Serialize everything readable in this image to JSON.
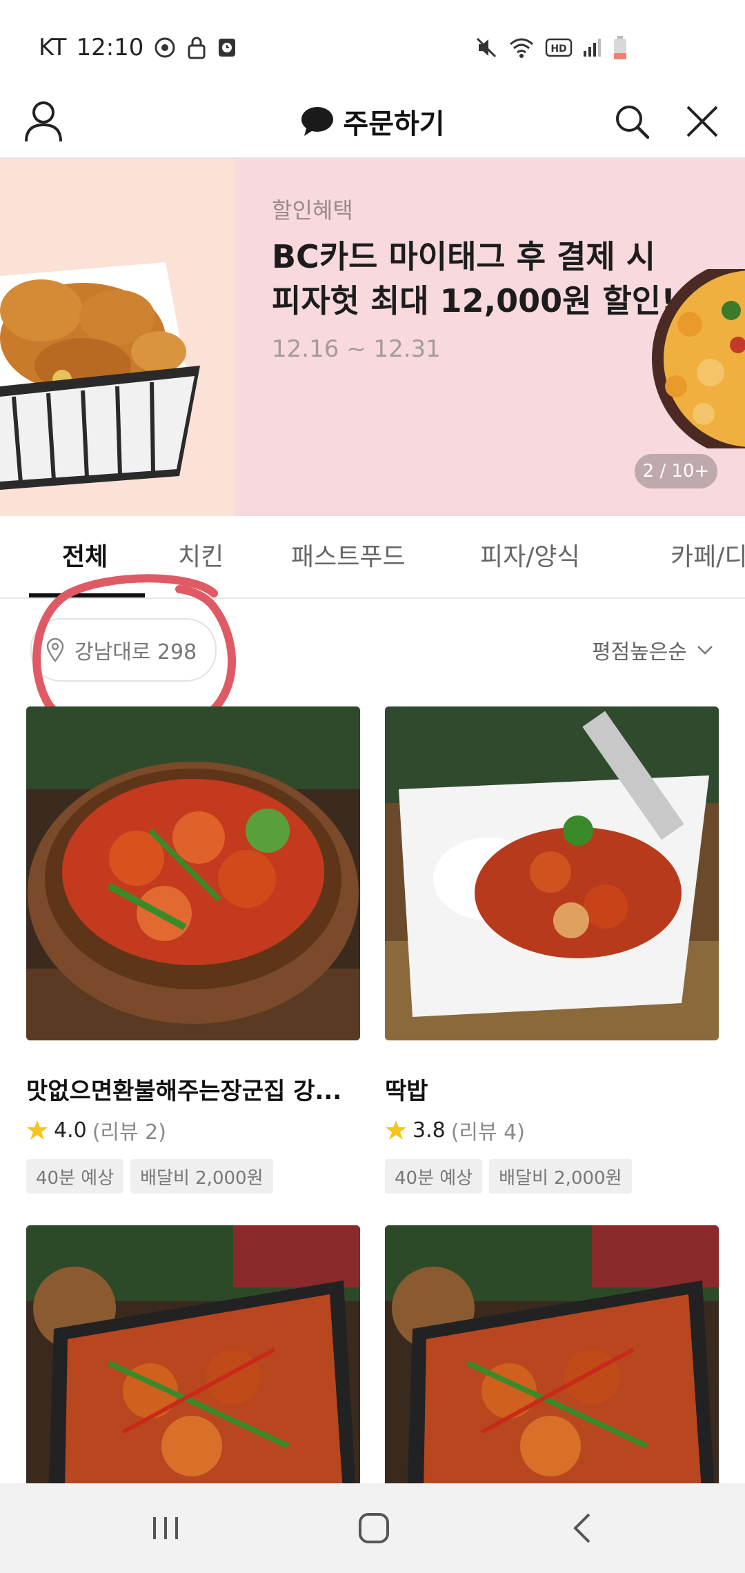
{
  "status_bar": {
    "carrier": "KT",
    "time": "12:10"
  },
  "header": {
    "title": "주문하기",
    "profile_icon": "person-icon",
    "search_icon": "search-icon",
    "close_icon": "close-icon"
  },
  "banner": {
    "label": "할인혜택",
    "headline_line1": "BC카드 마이태그 후 결제 시",
    "headline_line2": "피자헛 최대 12,000원 할인!",
    "date_range": "12.16 ~ 12.31",
    "counter": "2 / 10+"
  },
  "tabs": [
    {
      "label": "전체",
      "active": true
    },
    {
      "label": "치킨",
      "active": false
    },
    {
      "label": "패스트푸드",
      "active": false
    },
    {
      "label": "피자/양식",
      "active": false
    },
    {
      "label": "카페/디",
      "active": false
    }
  ],
  "filter": {
    "address": "강남대로 298",
    "sort": "평점높은순"
  },
  "restaurants": [
    {
      "name": "맛없으면환불해주는장군집 강...",
      "rating": "4.0",
      "reviews": "(리뷰 2)",
      "eta": "40분 예상",
      "fee": "배달비 2,000원"
    },
    {
      "name": "딱밥",
      "rating": "3.8",
      "reviews": "(리뷰 4)",
      "eta": "40분 예상",
      "fee": "배달비 2,000원"
    }
  ],
  "colors": {
    "banner_bg": "#f7d9de",
    "annotation": "#e05a66",
    "star": "#f5c518"
  }
}
